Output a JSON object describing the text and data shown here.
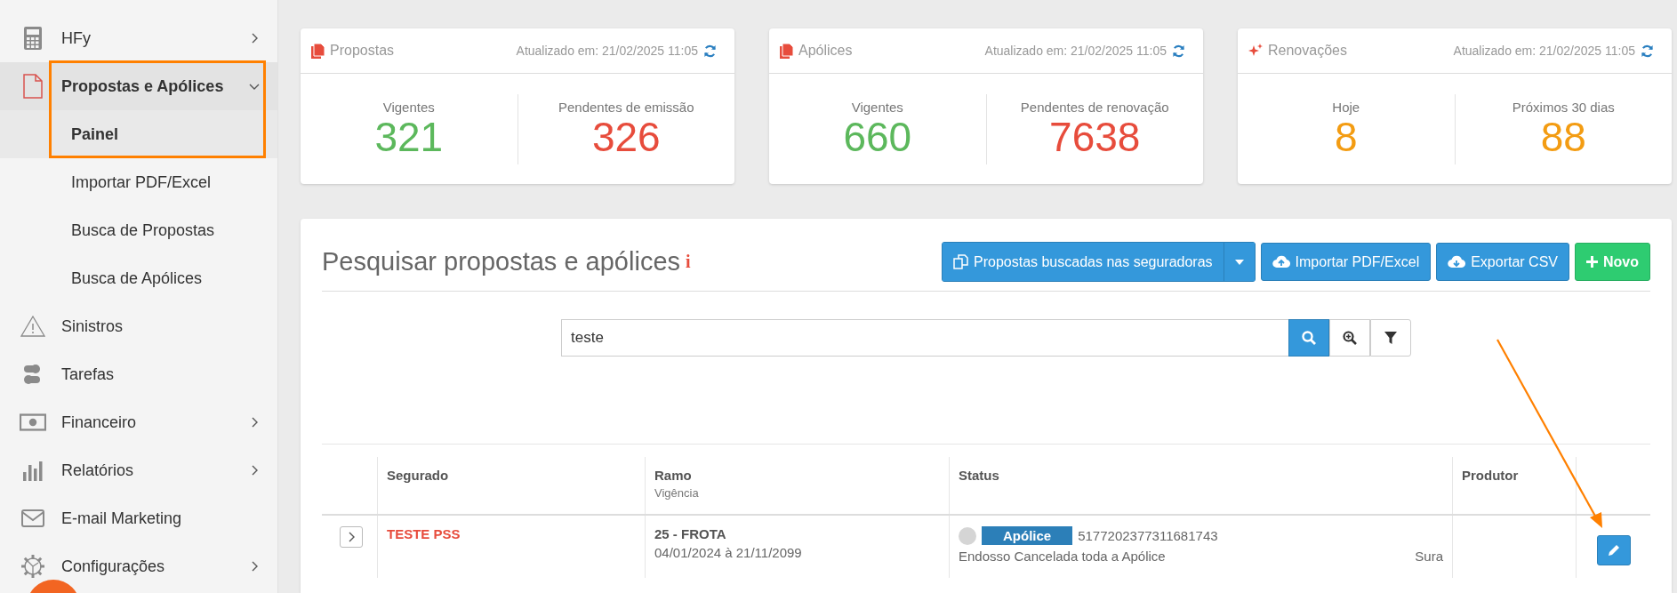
{
  "sidebar": {
    "items": [
      {
        "label": "HFy",
        "expandable": true,
        "expanded": false,
        "selected": false
      },
      {
        "label": "Propostas e Apólices",
        "expandable": true,
        "expanded": true,
        "selected": true,
        "children": [
          {
            "label": "Painel",
            "selected": true
          },
          {
            "label": "Importar PDF/Excel",
            "selected": false
          },
          {
            "label": "Busca de Propostas",
            "selected": false
          },
          {
            "label": "Busca de Apólices",
            "selected": false
          }
        ]
      },
      {
        "label": "Sinistros",
        "expandable": false,
        "selected": false
      },
      {
        "label": "Tarefas",
        "expandable": false,
        "selected": false
      },
      {
        "label": "Financeiro",
        "expandable": true,
        "expanded": false,
        "selected": false
      },
      {
        "label": "Relatórios",
        "expandable": true,
        "expanded": false,
        "selected": false
      },
      {
        "label": "E-mail Marketing",
        "expandable": false,
        "selected": false
      },
      {
        "label": "Configurações",
        "expandable": true,
        "expanded": false,
        "selected": false
      }
    ]
  },
  "cards": [
    {
      "title": "Propostas",
      "updated": "Atualizado em: 21/02/2025 11:05",
      "stats": [
        {
          "label": "Vigentes",
          "value": "321",
          "color": "#5cb85c"
        },
        {
          "label": "Pendentes de emissão",
          "value": "326",
          "color": "#e74c3c"
        }
      ]
    },
    {
      "title": "Apólices",
      "updated": "Atualizado em: 21/02/2025 11:05",
      "stats": [
        {
          "label": "Vigentes",
          "value": "660",
          "color": "#5cb85c"
        },
        {
          "label": "Pendentes de renovação",
          "value": "7638",
          "color": "#e74c3c"
        }
      ]
    },
    {
      "title": "Renovações",
      "updated": "Atualizado em: 21/02/2025 11:05",
      "stats": [
        {
          "label": "Hoje",
          "value": "8",
          "color": "#f39c12"
        },
        {
          "label": "Próximos 30 dias",
          "value": "88",
          "color": "#f39c12"
        }
      ]
    }
  ],
  "search_panel": {
    "title": "Pesquisar propostas e apólices",
    "info": "i",
    "buttons": [
      {
        "label": "Propostas buscadas nas seguradoras",
        "kind": "split"
      },
      {
        "label": "Importar PDF/Excel",
        "kind": "upload"
      },
      {
        "label": "Exportar CSV",
        "kind": "download"
      },
      {
        "label": "Novo",
        "kind": "new"
      }
    ],
    "search": {
      "value": "teste"
    }
  },
  "table": {
    "columns": [
      {
        "label": "Segurado"
      },
      {
        "label": "Ramo",
        "sublabel": "Vigência"
      },
      {
        "label": "Status"
      },
      {
        "label": "Produtor"
      }
    ],
    "rows": [
      {
        "segurado": "TESTE PSS",
        "ramo": "25 - FROTA",
        "vigencia": "04/01/2024 à 21/11/2099",
        "status_badge": "Apólice",
        "number": "5177202377311681743",
        "note": "Endosso Cancelada toda a Apólice",
        "insurer": "Sura"
      }
    ]
  }
}
